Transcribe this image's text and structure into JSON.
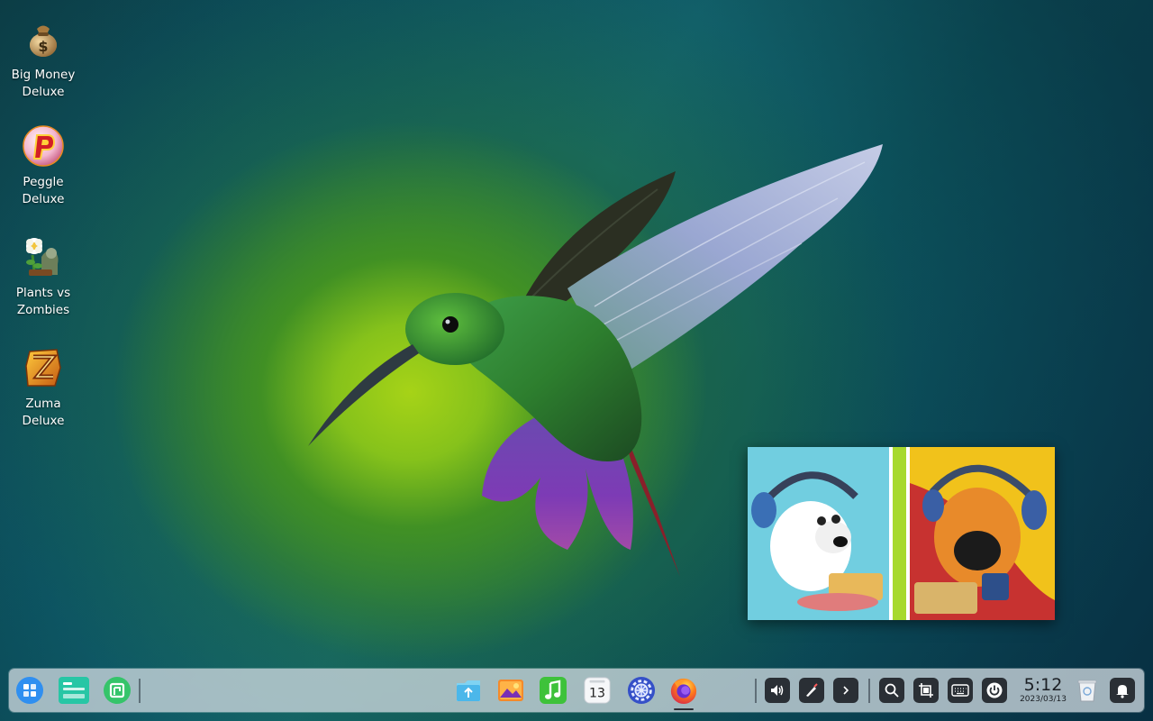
{
  "desktop": {
    "icons": [
      {
        "label": "Big Money\nDeluxe",
        "icon": "money-bag-icon"
      },
      {
        "label": "Peggle\nDeluxe",
        "icon": "peggle-icon"
      },
      {
        "label": "Plants vs\nZombies",
        "icon": "plants-vs-zombies-icon"
      },
      {
        "label": "Zuma\nDeluxe",
        "icon": "zuma-icon"
      }
    ],
    "wallpaper": "hummingbird"
  },
  "taskbar": {
    "left": [
      "launcher-icon",
      "multitask-view-icon",
      "workspace-icon"
    ],
    "apps": [
      "file-manager-icon",
      "image-viewer-icon",
      "music-player-icon",
      "calendar-icon",
      "settings-icon",
      "firefox-icon"
    ],
    "calendar_day": "13",
    "tray": [
      "volume-icon",
      "stylus-icon",
      "expand-chevron-icon",
      "search-icon",
      "screenshot-icon",
      "keyboard-icon",
      "power-icon"
    ],
    "clock_time": "5:12",
    "clock_date": "2023/03/13",
    "right": [
      "trash-icon",
      "notification-bell-icon"
    ]
  },
  "colors": {
    "taskbar_bg": "#cdd7de",
    "tray_button": "#2a2f35",
    "launcher_blue": "#2f8ff0",
    "accent_green": "#35c46a"
  }
}
